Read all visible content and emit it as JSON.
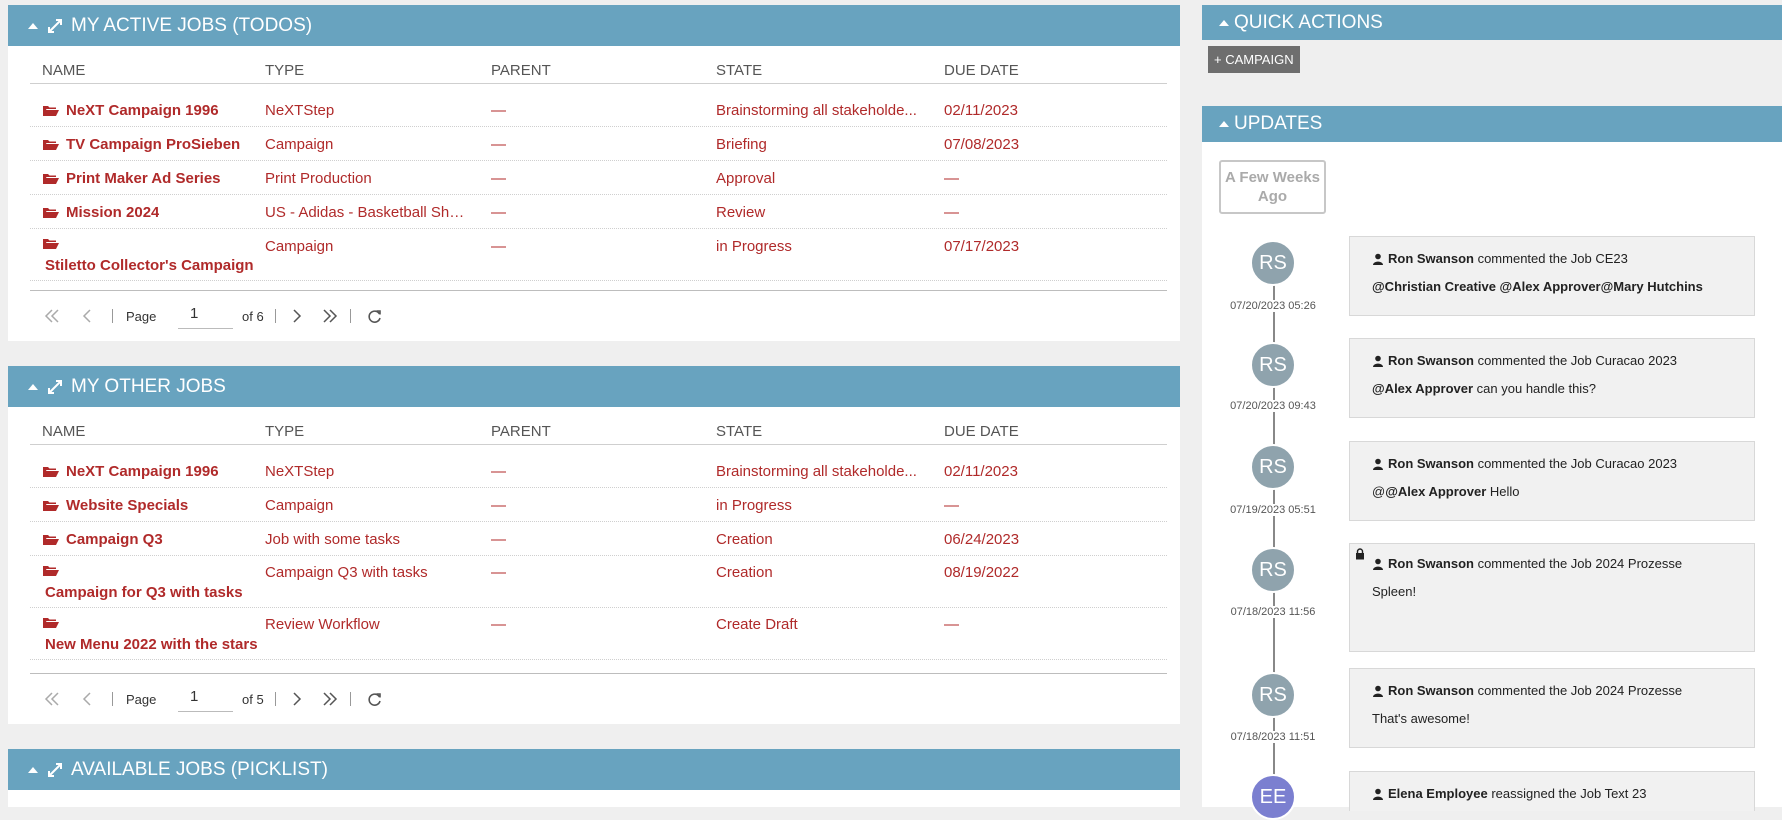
{
  "active_jobs": {
    "title": "MY ACTIVE JOBS (TODOS)",
    "columns": [
      "NAME",
      "TYPE",
      "PARENT",
      "STATE",
      "DUE DATE"
    ],
    "rows": [
      {
        "name": "NeXT Campaign 1996",
        "type": "NeXTStep",
        "parent": "—",
        "state": "Brainstorming all stakeholde...",
        "due": "02/11/2023"
      },
      {
        "name": "TV Campaign ProSieben",
        "type": "Campaign",
        "parent": "—",
        "state": "Briefing",
        "due": "07/08/2023"
      },
      {
        "name": "Print Maker Ad Series",
        "type": "Print Production",
        "parent": "—",
        "state": "Approval",
        "due": "—"
      },
      {
        "name": "Mission 2024",
        "type": "US - Adidas - Basketball Sho...",
        "parent": "—",
        "state": "Review",
        "due": "—"
      },
      {
        "name": "Stiletto Collector's Campaign",
        "type": "Campaign",
        "parent": "—",
        "state": "in Progress",
        "due": "07/17/2023"
      }
    ],
    "pager": {
      "page_label": "Page",
      "page": "1",
      "of": "of 6"
    }
  },
  "other_jobs": {
    "title": "MY OTHER JOBS",
    "columns": [
      "NAME",
      "TYPE",
      "PARENT",
      "STATE",
      "DUE DATE"
    ],
    "rows": [
      {
        "name": "NeXT Campaign 1996",
        "type": "NeXTStep",
        "parent": "—",
        "state": "Brainstorming all stakeholde...",
        "due": "02/11/2023"
      },
      {
        "name": "Website Specials",
        "type": "Campaign",
        "parent": "—",
        "state": "in Progress",
        "due": "—"
      },
      {
        "name": "Campaign Q3",
        "type": "Job with some tasks",
        "parent": "—",
        "state": "Creation",
        "due": "06/24/2023"
      },
      {
        "name": "Campaign for Q3 with tasks",
        "type": "Campaign Q3 with tasks",
        "parent": "—",
        "state": "Creation",
        "due": "08/19/2022"
      },
      {
        "name": "New Menu 2022 with the stars",
        "type": "Review Workflow",
        "parent": "—",
        "state": "Create Draft",
        "due": "—"
      }
    ],
    "pager": {
      "page_label": "Page",
      "page": "1",
      "of": "of 5"
    }
  },
  "available_jobs": {
    "title": "AVAILABLE JOBS (PICKLIST)"
  },
  "quick_actions": {
    "title": "QUICK ACTIONS",
    "campaign_button": "+ CAMPAIGN"
  },
  "updates": {
    "title": "UPDATES",
    "group_label": "A Few Weeks Ago",
    "items": [
      {
        "initials": "RS",
        "timestamp": "07/20/2023 05:26",
        "user": "Ron Swanson",
        "action": "commented the Job CE23",
        "msg_bold": "@Christian Creative @Alex Approver@Mary Hutchins",
        "msg_prefix": "",
        "msg_rest": ""
      },
      {
        "initials": "RS",
        "timestamp": "07/20/2023 09:43",
        "user": "Ron Swanson",
        "action": "commented the Job Curacao 2023",
        "msg_bold": "@Alex Approver",
        "msg_prefix": "",
        "msg_rest": " can you handle this?"
      },
      {
        "initials": "RS",
        "timestamp": "07/19/2023 05:51",
        "user": "Ron Swanson",
        "action": "commented the Job Curacao 2023",
        "msg_bold": "@Alex Approver",
        "msg_prefix": "@",
        "msg_rest": " Hello"
      },
      {
        "initials": "RS",
        "timestamp": "07/18/2023 11:56",
        "user": "Ron Swanson",
        "action": "commented the Job 2024 Prozesse",
        "msg_bold": "",
        "msg_prefix": "",
        "msg_rest": "Spleen!",
        "locked": true
      },
      {
        "initials": "RS",
        "timestamp": "07/18/2023 11:51",
        "user": "Ron Swanson",
        "action": "commented the Job 2024 Prozesse",
        "msg_bold": "",
        "msg_prefix": "",
        "msg_rest": "That's awesome!"
      },
      {
        "initials": "EE",
        "timestamp": "",
        "user": "Elena Employee",
        "action": "reassigned the Job Text 23",
        "msg_bold": "",
        "msg_prefix": "",
        "msg_rest": ""
      }
    ]
  },
  "colors": {
    "header": "#68a3bf",
    "link_red": "#b02a2a",
    "button_gray": "#6e6e6e"
  }
}
